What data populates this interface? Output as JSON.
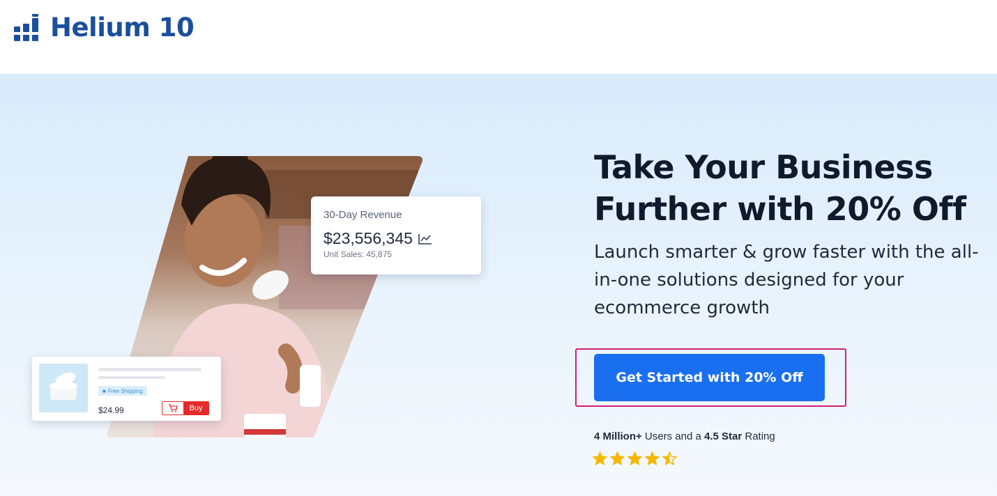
{
  "brand": {
    "name": "Helium 10",
    "color": "#1a4f9c"
  },
  "hero": {
    "headline_line1": "Take Your Business",
    "headline_line2": "Further with 20% Off",
    "subheadline": "Launch smarter & grow faster with the all-in-one solutions designed for your ecommerce growth",
    "cta_label": "Get Started with 20% Off",
    "cta_color": "#1a6ff0",
    "highlight_color": "#d21d7a",
    "social_proof": {
      "users": "4 Million+",
      "users_suffix": " Users and a ",
      "rating": "4.5 Star",
      "rating_suffix": " Rating"
    },
    "rating_stars": 4.5
  },
  "revenue_card": {
    "title": "30-Day Revenue",
    "value": "$23,556,345",
    "icon": "line-chart-icon",
    "unit_sales": "Unit Sales: 45,875"
  },
  "product_card": {
    "shipping_badge": "Free Shipping",
    "price": "$24.99",
    "buy_label": "Buy",
    "cart_icon": "cart-icon"
  }
}
